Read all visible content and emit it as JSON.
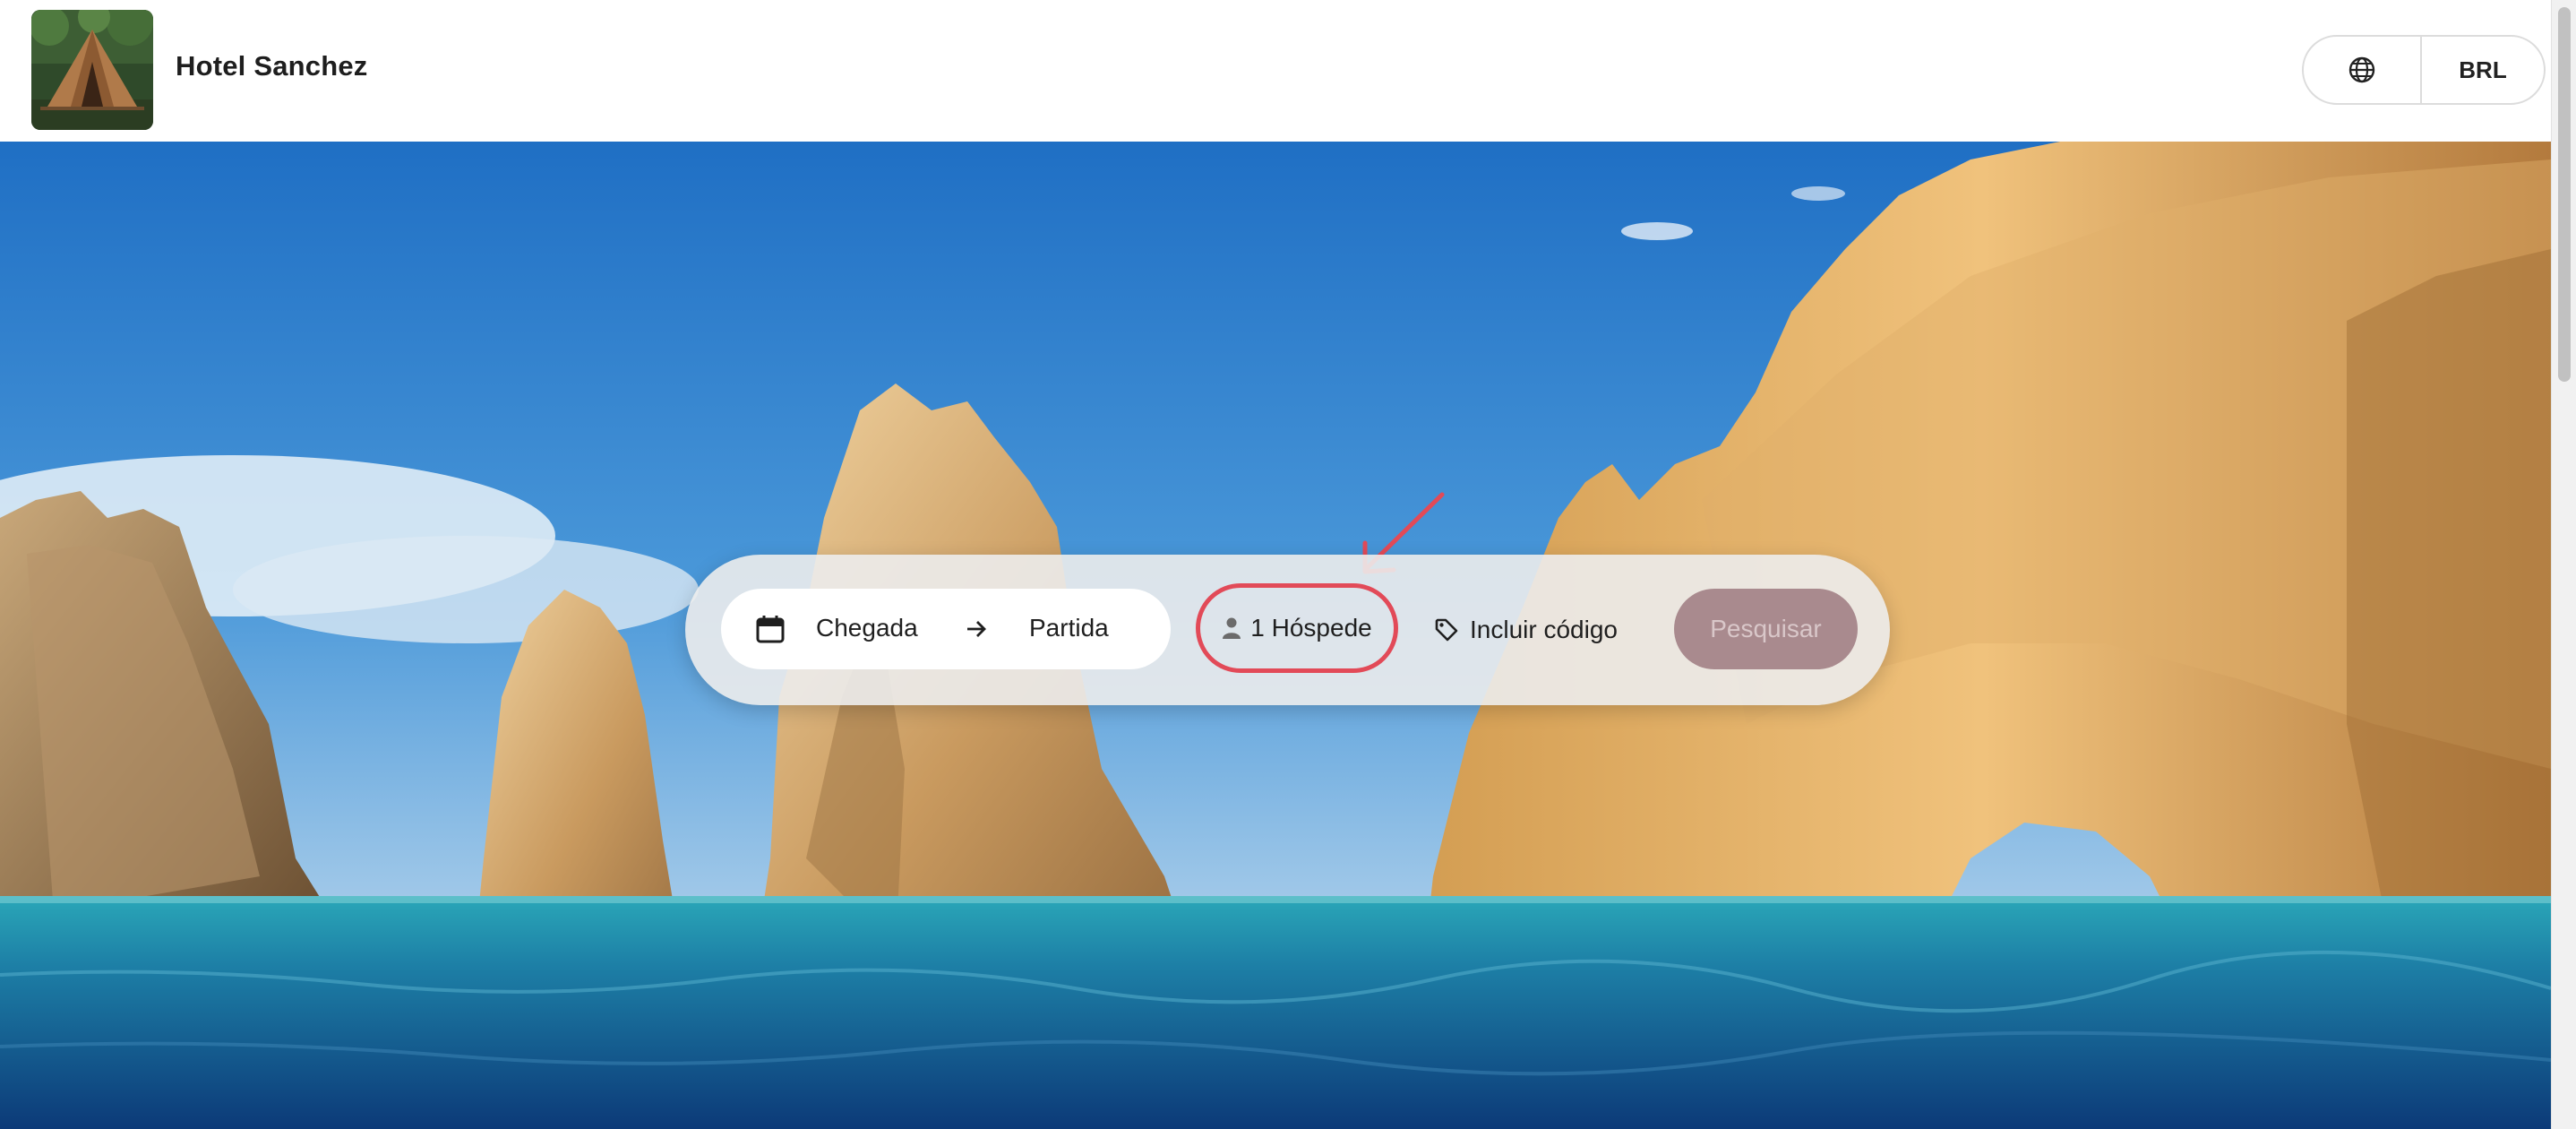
{
  "header": {
    "hotel_name": "Hotel Sanchez",
    "logo_icon": "tent-photo-logo",
    "language_icon": "globe-icon",
    "currency": "BRL"
  },
  "search": {
    "checkin_label": "Chegada",
    "checkout_label": "Partida",
    "date_icon": "calendar-icon",
    "date_separator_icon": "arrow-right-icon",
    "guests_label": "1 Hóspede",
    "guests_icon": "person-icon",
    "promo_label": "Incluir código",
    "promo_icon": "tag-icon",
    "search_label": "Pesquisar"
  },
  "colors": {
    "highlight": "#e24a58",
    "search_button": "#a98a8e",
    "search_button_text": "#d9c7c9"
  }
}
